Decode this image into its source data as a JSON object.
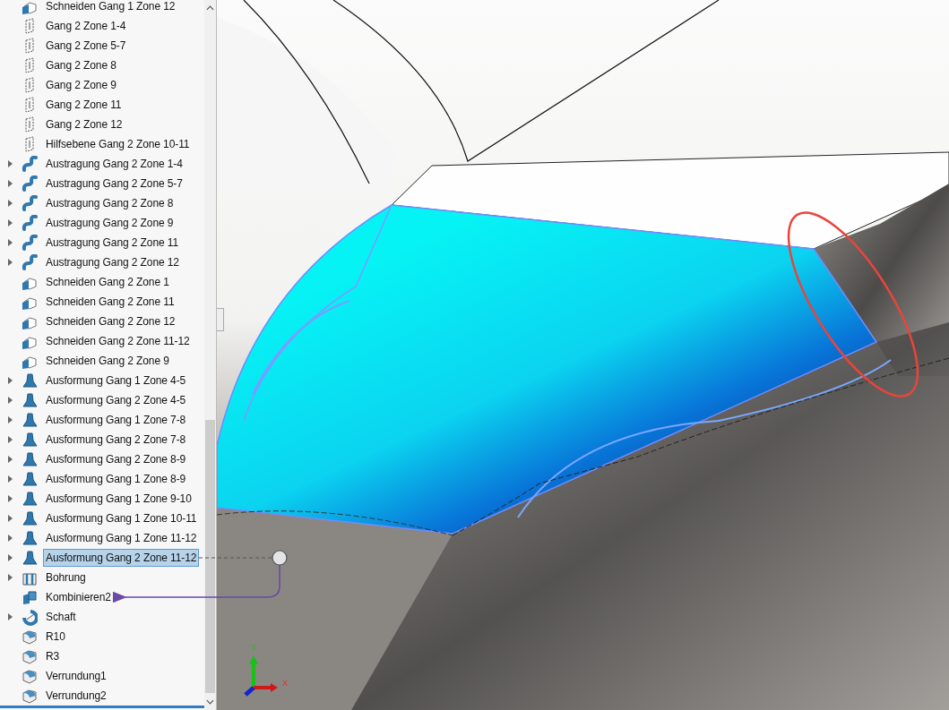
{
  "feature_tree": {
    "items": [
      {
        "label": "Schneiden Gang 1 Zone 12",
        "kind": "cut",
        "expandable": false,
        "selected": false
      },
      {
        "label": "Gang 2 Zone 1-4",
        "kind": "plane",
        "expandable": false,
        "selected": false
      },
      {
        "label": "Gang 2 Zone 5-7",
        "kind": "plane",
        "expandable": false,
        "selected": false
      },
      {
        "label": "Gang 2 Zone 8",
        "kind": "plane",
        "expandable": false,
        "selected": false
      },
      {
        "label": "Gang 2 Zone 9",
        "kind": "plane",
        "expandable": false,
        "selected": false
      },
      {
        "label": "Gang 2 Zone 11",
        "kind": "plane",
        "expandable": false,
        "selected": false
      },
      {
        "label": "Gang 2 Zone 12",
        "kind": "plane",
        "expandable": false,
        "selected": false
      },
      {
        "label": "Hilfsebene Gang 2 Zone 10-11",
        "kind": "plane",
        "expandable": false,
        "selected": false
      },
      {
        "label": "Austragung Gang 2 Zone 1-4",
        "kind": "sweep",
        "expandable": true,
        "selected": false
      },
      {
        "label": "Austragung Gang 2 Zone 5-7",
        "kind": "sweep",
        "expandable": true,
        "selected": false
      },
      {
        "label": "Austragung Gang 2 Zone 8",
        "kind": "sweep",
        "expandable": true,
        "selected": false
      },
      {
        "label": "Austragung Gang 2 Zone 9",
        "kind": "sweep",
        "expandable": true,
        "selected": false
      },
      {
        "label": "Austragung Gang 2 Zone 11",
        "kind": "sweep",
        "expandable": true,
        "selected": false
      },
      {
        "label": "Austragung Gang 2 Zone 12",
        "kind": "sweep",
        "expandable": true,
        "selected": false
      },
      {
        "label": "Schneiden Gang 2 Zone 1",
        "kind": "cut",
        "expandable": false,
        "selected": false
      },
      {
        "label": "Schneiden Gang 2 Zone 11",
        "kind": "cut",
        "expandable": false,
        "selected": false
      },
      {
        "label": "Schneiden Gang 2 Zone 12",
        "kind": "cut",
        "expandable": false,
        "selected": false
      },
      {
        "label": "Schneiden Gang 2 Zone 11-12",
        "kind": "cut",
        "expandable": false,
        "selected": false
      },
      {
        "label": "Schneiden Gang 2 Zone 9",
        "kind": "cut",
        "expandable": false,
        "selected": false
      },
      {
        "label": "Ausformung Gang 1 Zone 4-5",
        "kind": "loft",
        "expandable": true,
        "selected": false
      },
      {
        "label": "Ausformung Gang 2 Zone 4-5",
        "kind": "loft",
        "expandable": true,
        "selected": false
      },
      {
        "label": "Ausformung Gang 1 Zone 7-8",
        "kind": "loft",
        "expandable": true,
        "selected": false
      },
      {
        "label": "Ausformung Gang 2 Zone 7-8",
        "kind": "loft",
        "expandable": true,
        "selected": false
      },
      {
        "label": "Ausformung Gang 2 Zone 8-9",
        "kind": "loft",
        "expandable": true,
        "selected": false
      },
      {
        "label": "Ausformung Gang 1 Zone 8-9",
        "kind": "loft",
        "expandable": true,
        "selected": false
      },
      {
        "label": "Ausformung Gang 1 Zone 9-10",
        "kind": "loft",
        "expandable": true,
        "selected": false
      },
      {
        "label": "Ausformung Gang 1 Zone 10-11",
        "kind": "loft",
        "expandable": true,
        "selected": false
      },
      {
        "label": "Ausformung Gang 1 Zone 11-12",
        "kind": "loft",
        "expandable": true,
        "selected": false
      },
      {
        "label": "Ausformung Gang 2 Zone 11-12",
        "kind": "loft",
        "expandable": true,
        "selected": true
      },
      {
        "label": "Bohrung",
        "kind": "hole",
        "expandable": true,
        "selected": false
      },
      {
        "label": "Kombinieren2",
        "kind": "combine",
        "expandable": false,
        "selected": false
      },
      {
        "label": "Schaft",
        "kind": "revolve",
        "expandable": true,
        "selected": false
      },
      {
        "label": "R10",
        "kind": "fillet",
        "expandable": false,
        "selected": false
      },
      {
        "label": "R3",
        "kind": "fillet",
        "expandable": false,
        "selected": false
      },
      {
        "label": "Verrundung1",
        "kind": "fillet",
        "expandable": false,
        "selected": false
      },
      {
        "label": "Verrundung2",
        "kind": "fillet",
        "expandable": false,
        "selected": false
      }
    ]
  },
  "viewport": {
    "triad": {
      "y_label": "Y",
      "x_label": "X"
    }
  }
}
